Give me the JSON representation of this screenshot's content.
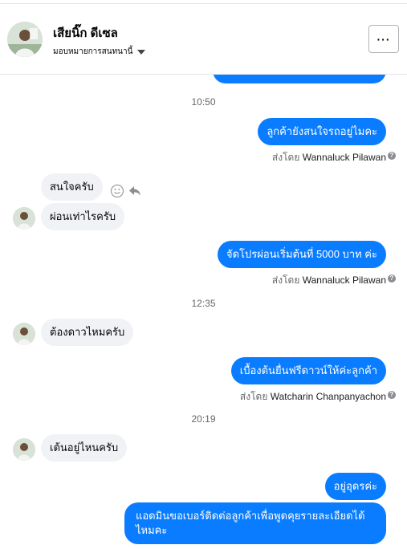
{
  "header": {
    "contact_name": "เสียนิ๊ก ดีเซล",
    "assign_label": "มอบหมายการสนทนานี้",
    "more_label": "···"
  },
  "messages": {
    "cut_top": "",
    "time1": "10:50",
    "m1": "ลูกค้ายังสนใจรถอยู่ไมคะ",
    "m1_sent_prefix": "ส่งโดย",
    "m1_sender": "Wannaluck Pilawan",
    "m2": "สนใจครับ",
    "m3": "ผ่อนเท่าไรครับ",
    "m4": "จัดโปรผ่อนเริ่มต้นที่ 5000 บาท ค่ะ",
    "m4_sent_prefix": "ส่งโดย",
    "m4_sender": "Wannaluck Pilawan",
    "time2": "12:35",
    "m5": "ต้องดาวไหมครับ",
    "m6": "เบื้องต้นยื่นฟรีดาวน์ให้ค่ะลูกค้า",
    "m6_sent_prefix": "ส่งโดย",
    "m6_sender": "Watcharin Chanpanyachon",
    "time3": "20:19",
    "m7": "เต้นอยู่ไหนครับ",
    "m8": "อยู่อุดรค่ะ",
    "m9_line1": "แอดมินขอเบอร์ติดต่อลูกค้าเพื่อพูดคุยรายละเอียดได้",
    "m9_line2": "ไหมคะ"
  },
  "icons": {
    "help": "?",
    "smile": "smile-icon",
    "reply": "reply-icon"
  }
}
